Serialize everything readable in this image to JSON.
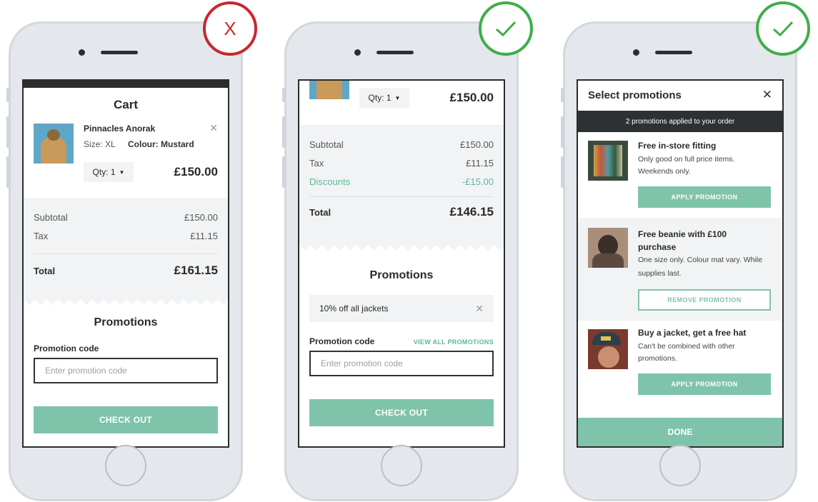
{
  "phone1": {
    "badge": "X",
    "cart_title": "Cart",
    "product": {
      "name": "Pinnacles Anorak",
      "size": "Size: XL",
      "colour": "Colour: Mustard",
      "qty": "Qty: 1",
      "price": "£150.00"
    },
    "summary": {
      "subtotal_label": "Subtotal",
      "subtotal": "£150.00",
      "tax_label": "Tax",
      "tax": "£11.15",
      "total_label": "Total",
      "total": "£161.15"
    },
    "promotions_title": "Promotions",
    "promo_code_label": "Promotion code",
    "promo_placeholder": "Enter promotion code",
    "checkout": "CHECK OUT"
  },
  "phone2": {
    "qty": "Qty: 1",
    "price": "£150.00",
    "summary": {
      "subtotal_label": "Subtotal",
      "subtotal": "£150.00",
      "tax_label": "Tax",
      "tax": "£11.15",
      "discounts_label": "Discounts",
      "discounts": "-£15.00",
      "total_label": "Total",
      "total": "£146.15"
    },
    "promotions_title": "Promotions",
    "applied_promo": "10% off all jackets",
    "promo_code_label": "Promotion code",
    "view_all": "VIEW ALL PROMOTIONS",
    "promo_placeholder": "Enter promotion code",
    "checkout": "CHECK OUT"
  },
  "phone3": {
    "title": "Select promotions",
    "banner": "2 promotions applied to your order",
    "promos": [
      {
        "title": "Free in-store fitting",
        "desc": "Only good on full price items. Weekends only.",
        "button": "APPLY PROMOTION"
      },
      {
        "title": "Free beanie with £100 purchase",
        "desc": "One size only. Colour mat vary. While supplies last.",
        "button": "REMOVE PROMOTION"
      },
      {
        "title": "Buy a jacket, get a free hat",
        "desc": "Can't be combined with other promotions.",
        "button": "APPLY PROMOTION"
      }
    ],
    "done": "DONE"
  },
  "colors": {
    "accent": "#7fc4aa",
    "bad": "#c8272e",
    "good": "#3fae49",
    "discount": "#5cb89a"
  }
}
